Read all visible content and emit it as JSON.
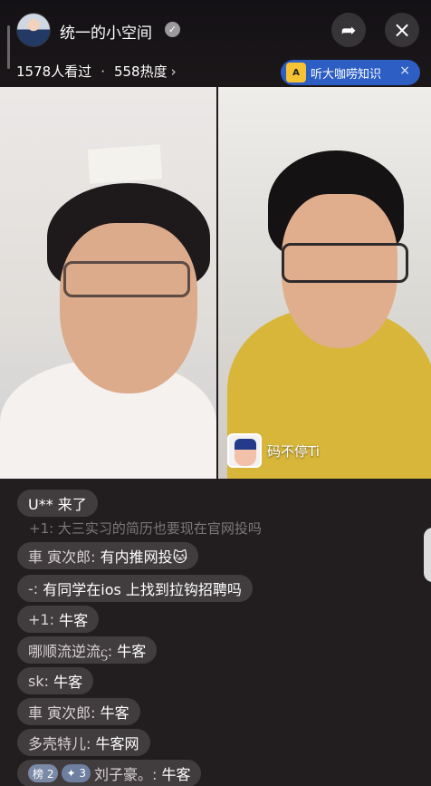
{
  "header": {
    "host_name": "统一的小空间",
    "verified_icon": "✓",
    "viewers": "1578人看过",
    "separator": "·",
    "heat": "558热度",
    "chevron": "›",
    "promo_label": "听大咖唠知识",
    "promo_icon_text": "A",
    "promo_close": "×",
    "share_icon": "➦",
    "close_icon": "×"
  },
  "guest": {
    "name": "码不停Ti"
  },
  "chat": {
    "entry": "U** 来了",
    "faded_line": "+1: 大三实习的简历也要现在官网投吗",
    "messages": [
      {
        "user": "車 寅次郎:",
        "text": "有内推网投🐱"
      },
      {
        "user": "-:",
        "text": "有同学在ios 上找到拉钩招聘吗"
      },
      {
        "user": "+1:",
        "text": "牛客"
      },
      {
        "user": "哪顺流逆流ᦓ:",
        "text": "牛客"
      },
      {
        "user": "sk:",
        "text": "牛客"
      },
      {
        "user": "車 寅次郎:",
        "text": "牛客"
      },
      {
        "user": "多壳特儿:",
        "text": "牛客网"
      }
    ],
    "last": {
      "badge1": "榜 2",
      "badge2": "✦ 3",
      "user": "刘子豪。:",
      "text": "牛客"
    }
  }
}
